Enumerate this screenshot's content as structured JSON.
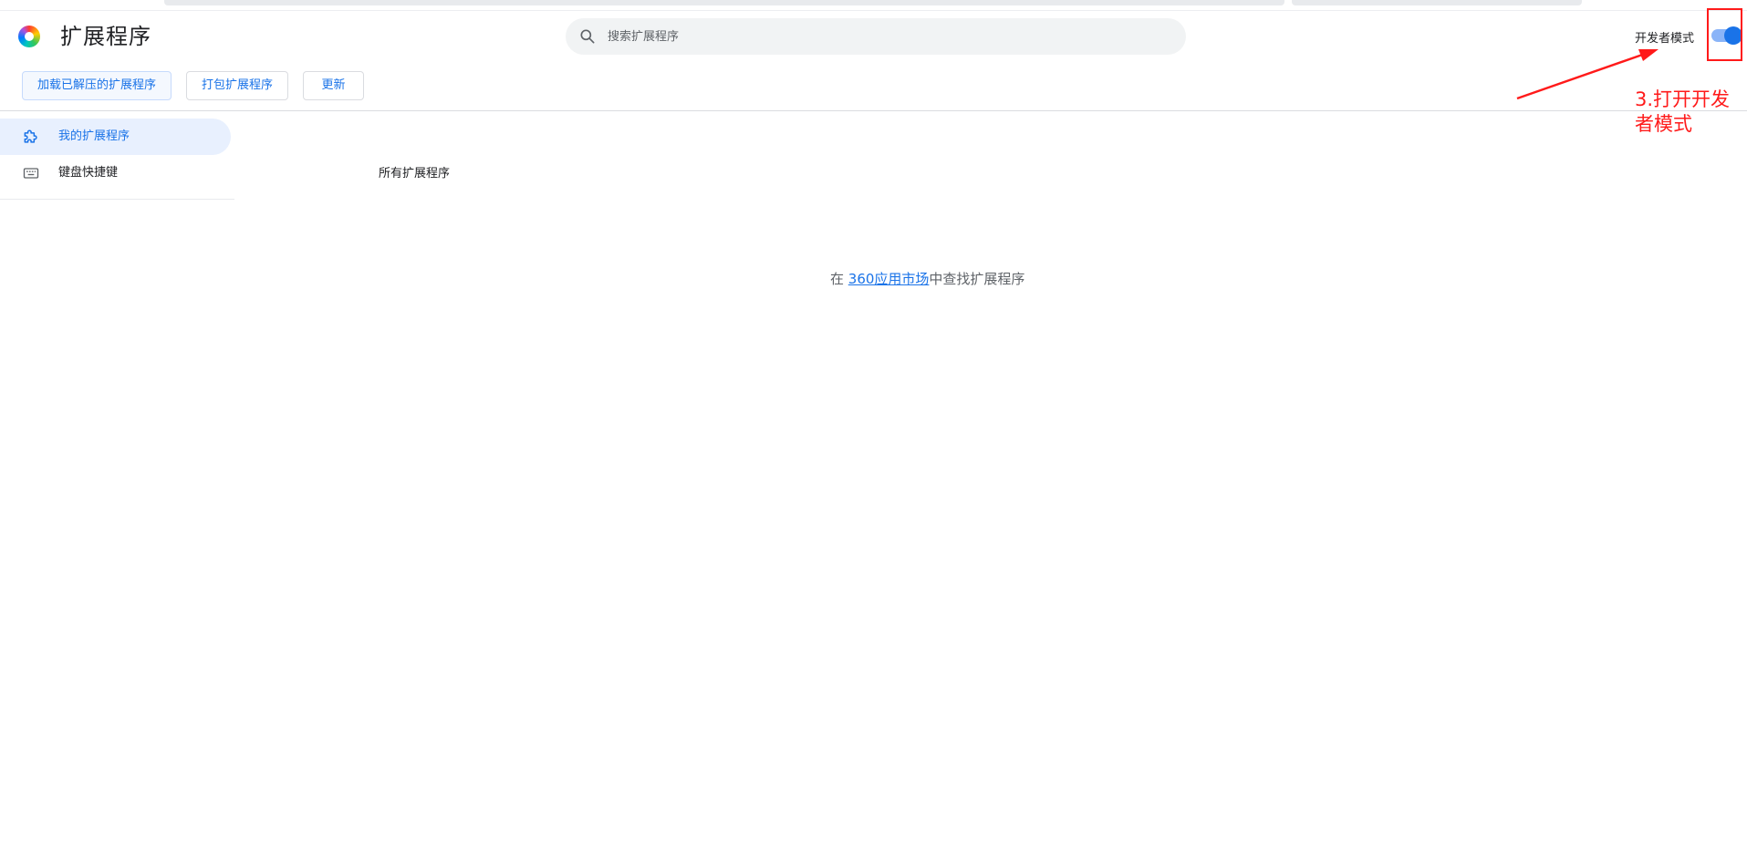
{
  "header": {
    "title": "扩展程序",
    "search": {
      "placeholder": "搜索扩展程序",
      "value": ""
    },
    "developer_mode": {
      "label": "开发者模式",
      "enabled": true
    }
  },
  "toolbar": {
    "load_unpacked_label": "加载已解压的扩展程序",
    "pack_label": "打包扩展程序",
    "update_label": "更新"
  },
  "sidebar": {
    "items": [
      {
        "label": "我的扩展程序",
        "icon": "puzzle-icon",
        "active": true
      },
      {
        "label": "键盘快捷键",
        "icon": "keyboard-icon",
        "active": false
      }
    ]
  },
  "main": {
    "section_title": "所有扩展程序",
    "market_prefix": "在 ",
    "market_link": "360应用市场",
    "market_suffix": "中查找扩展程序"
  },
  "annotation": {
    "text": "3.打开开发者模式"
  },
  "colors": {
    "accent": "#1a73e8",
    "annotation": "#ff1a1a",
    "active_bg": "#e8f0fe"
  }
}
